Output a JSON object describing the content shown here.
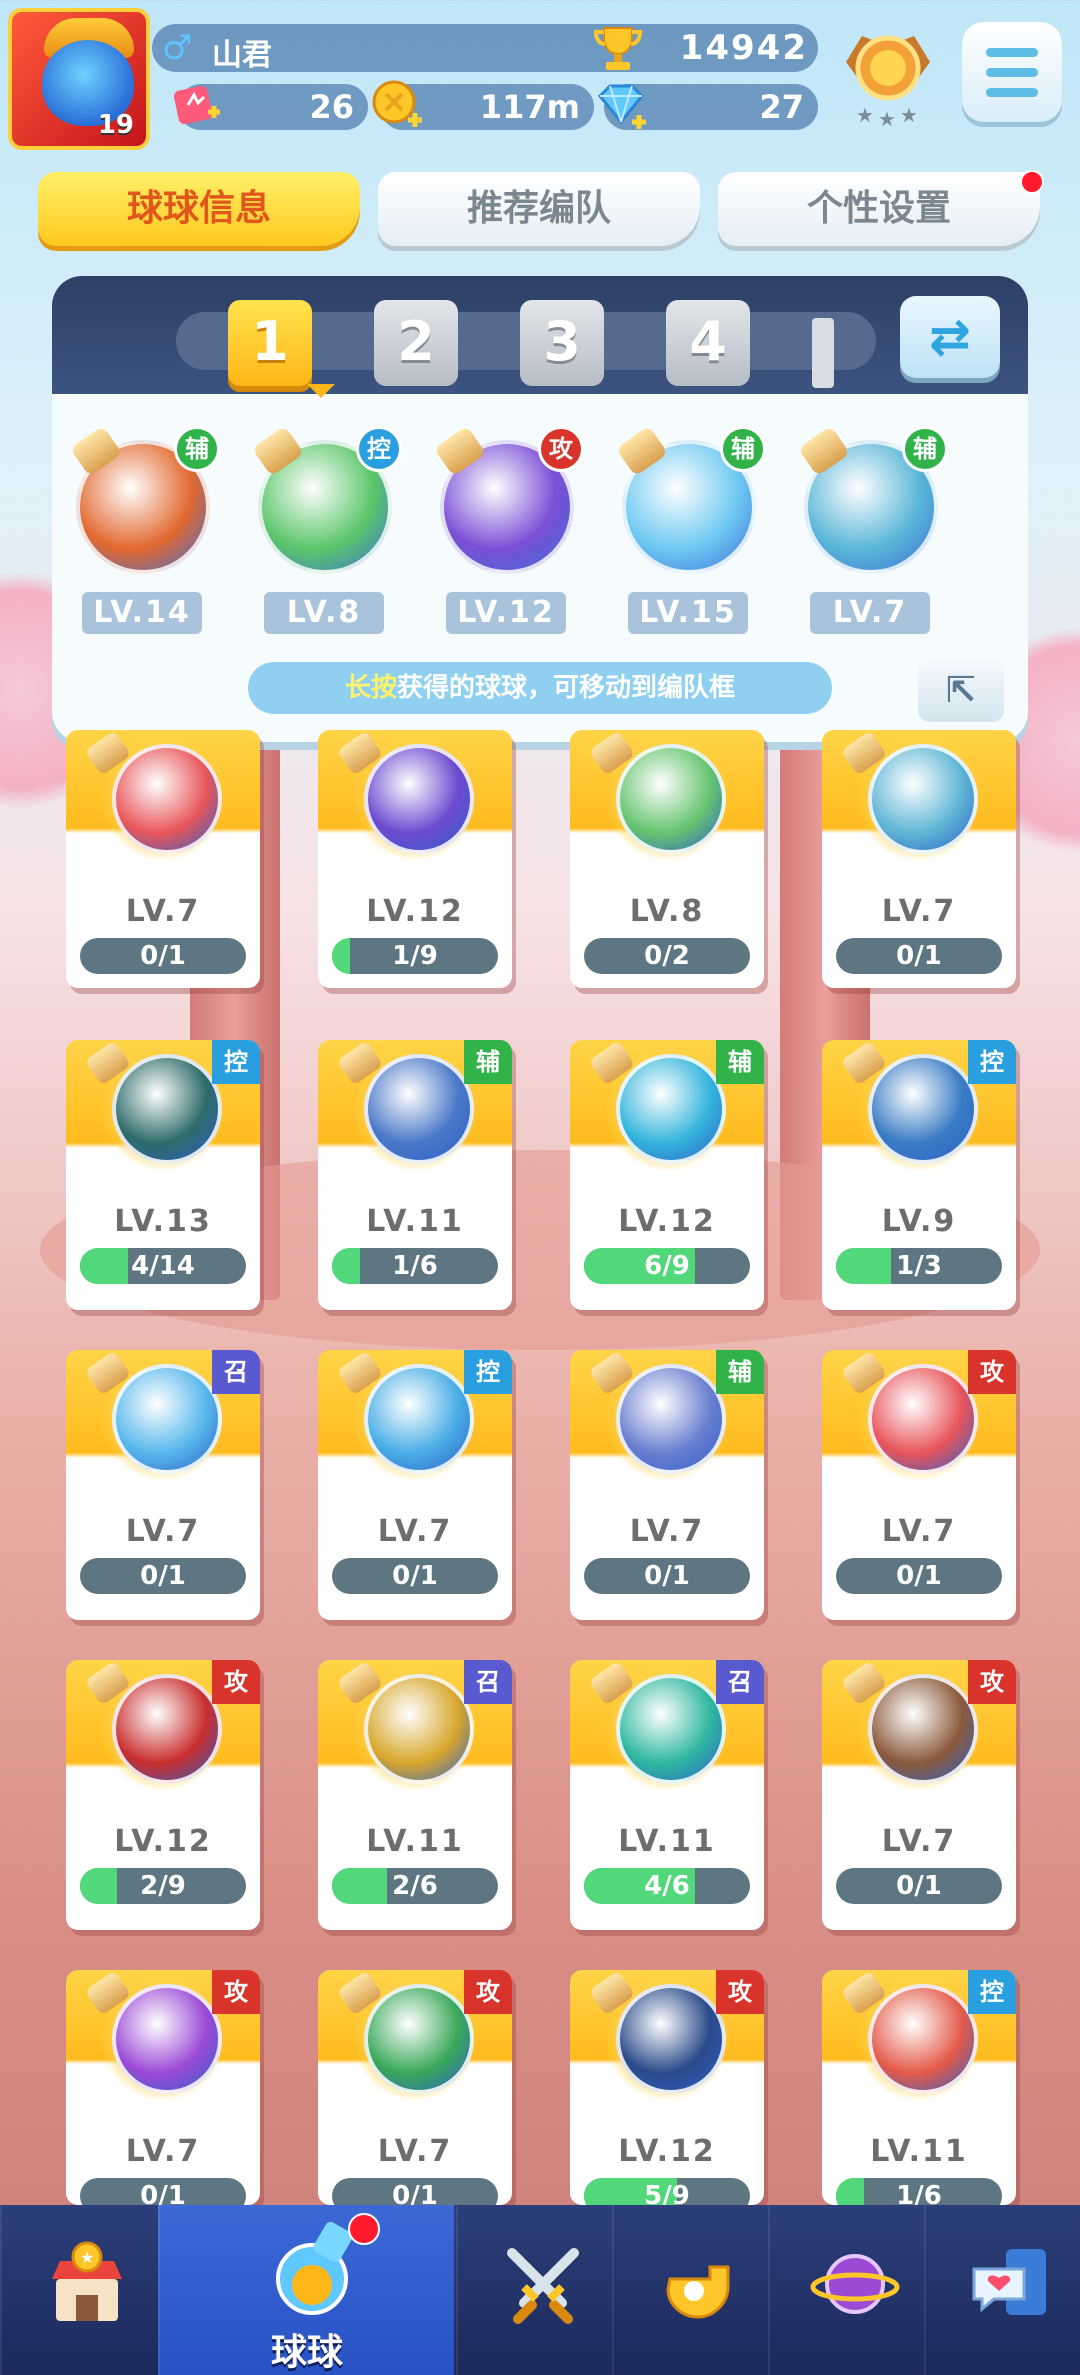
{
  "player": {
    "name": "山君",
    "avatar_level": "19",
    "trophies": "14942"
  },
  "resources": {
    "energy": "26",
    "gold": "117m",
    "diamonds": "27"
  },
  "tabs": [
    {
      "label": "球球信息",
      "active": true
    },
    {
      "label": "推荐编队",
      "active": false
    },
    {
      "label": "个性设置",
      "active": false,
      "badge": true
    }
  ],
  "team_slots": [
    "1",
    "2",
    "3",
    "4"
  ],
  "selected_slot": "1",
  "team": [
    {
      "level": "LV.14",
      "tag": "辅",
      "tag_color": "#32b34a",
      "orb": "#e2682f"
    },
    {
      "level": "LV.8",
      "tag": "控",
      "tag_color": "#2a9fe0",
      "orb": "#5bc66a"
    },
    {
      "level": "LV.12",
      "tag": "攻",
      "tag_color": "#d9342b",
      "orb": "#7b4fd6"
    },
    {
      "level": "LV.15",
      "tag": "辅",
      "tag_color": "#32b34a",
      "orb": "#6fc9f2"
    },
    {
      "level": "LV.7",
      "tag": "辅",
      "tag_color": "#32b34a",
      "orb": "#5bb7d8"
    }
  ],
  "hint": {
    "highlight": "长按",
    "text": "获得的球球，可移动到编队框"
  },
  "collection": [
    {
      "level": "LV.7",
      "progress": "0/1",
      "fill": 0,
      "tag": "",
      "tag_color": "#d9342b",
      "orb": "#e8565a"
    },
    {
      "level": "LV.12",
      "progress": "1/9",
      "fill": 0.11,
      "tag": "",
      "tag_color": "#d9342b",
      "orb": "#6d4ad0"
    },
    {
      "level": "LV.8",
      "progress": "0/2",
      "fill": 0,
      "tag": "",
      "tag_color": "#2a9fe0",
      "orb": "#66c46f"
    },
    {
      "level": "LV.7",
      "progress": "0/1",
      "fill": 0,
      "tag": "",
      "tag_color": "#32b34a",
      "orb": "#5fb6d5"
    },
    {
      "level": "LV.13",
      "progress": "4/14",
      "fill": 0.29,
      "tag": "控",
      "tag_color": "#2a9fe0",
      "orb": "#2e6b6a"
    },
    {
      "level": "LV.11",
      "progress": "1/6",
      "fill": 0.17,
      "tag": "辅",
      "tag_color": "#32b34a",
      "orb": "#4a78c8"
    },
    {
      "level": "LV.12",
      "progress": "6/9",
      "fill": 0.67,
      "tag": "辅",
      "tag_color": "#32b34a",
      "orb": "#34b5dc"
    },
    {
      "level": "LV.9",
      "progress": "1/3",
      "fill": 0.33,
      "tag": "控",
      "tag_color": "#2a9fe0",
      "orb": "#3a7cc4"
    },
    {
      "level": "LV.7",
      "progress": "0/1",
      "fill": 0,
      "tag": "召",
      "tag_color": "#5a5ad0",
      "orb": "#58b8ec"
    },
    {
      "level": "LV.7",
      "progress": "0/1",
      "fill": 0,
      "tag": "控",
      "tag_color": "#2a9fe0",
      "orb": "#4aaee6"
    },
    {
      "level": "LV.7",
      "progress": "0/1",
      "fill": 0,
      "tag": "辅",
      "tag_color": "#32b34a",
      "orb": "#6a7fd0"
    },
    {
      "level": "LV.7",
      "progress": "0/1",
      "fill": 0,
      "tag": "攻",
      "tag_color": "#d9342b",
      "orb": "#e8555b"
    },
    {
      "level": "LV.12",
      "progress": "2/9",
      "fill": 0.22,
      "tag": "攻",
      "tag_color": "#d9342b",
      "orb": "#c92e2e"
    },
    {
      "level": "LV.11",
      "progress": "2/6",
      "fill": 0.33,
      "tag": "召",
      "tag_color": "#5a5ad0",
      "orb": "#d8a72c"
    },
    {
      "level": "LV.11",
      "progress": "4/6",
      "fill": 0.67,
      "tag": "召",
      "tag_color": "#5a5ad0",
      "orb": "#2fb8a0"
    },
    {
      "level": "LV.7",
      "progress": "0/1",
      "fill": 0,
      "tag": "攻",
      "tag_color": "#d9342b",
      "orb": "#8b5a3c"
    },
    {
      "level": "LV.7",
      "progress": "0/1",
      "fill": 0,
      "tag": "攻",
      "tag_color": "#d9342b",
      "orb": "#9b4ad6"
    },
    {
      "level": "LV.7",
      "progress": "0/1",
      "fill": 0,
      "tag": "攻",
      "tag_color": "#d9342b",
      "orb": "#3aa85a"
    },
    {
      "level": "LV.12",
      "progress": "5/9",
      "fill": 0.56,
      "tag": "攻",
      "tag_color": "#d9342b",
      "orb": "#2a4a8a"
    },
    {
      "level": "LV.11",
      "progress": "1/6",
      "fill": 0.17,
      "tag": "控",
      "tag_color": "#2a9fe0",
      "orb": "#e45a4a"
    }
  ],
  "nav": [
    {
      "icon": "shop-icon",
      "label": "",
      "active": false
    },
    {
      "icon": "ball-bottle-icon",
      "label": "球球",
      "active": true,
      "badge": true
    },
    {
      "icon": "crossed-swords-icon",
      "label": "",
      "active": false
    },
    {
      "icon": "whistle-icon",
      "label": "",
      "active": false
    },
    {
      "icon": "planet-icon",
      "label": "",
      "active": false
    },
    {
      "icon": "chat-heart-icon",
      "label": "",
      "active": false
    }
  ]
}
